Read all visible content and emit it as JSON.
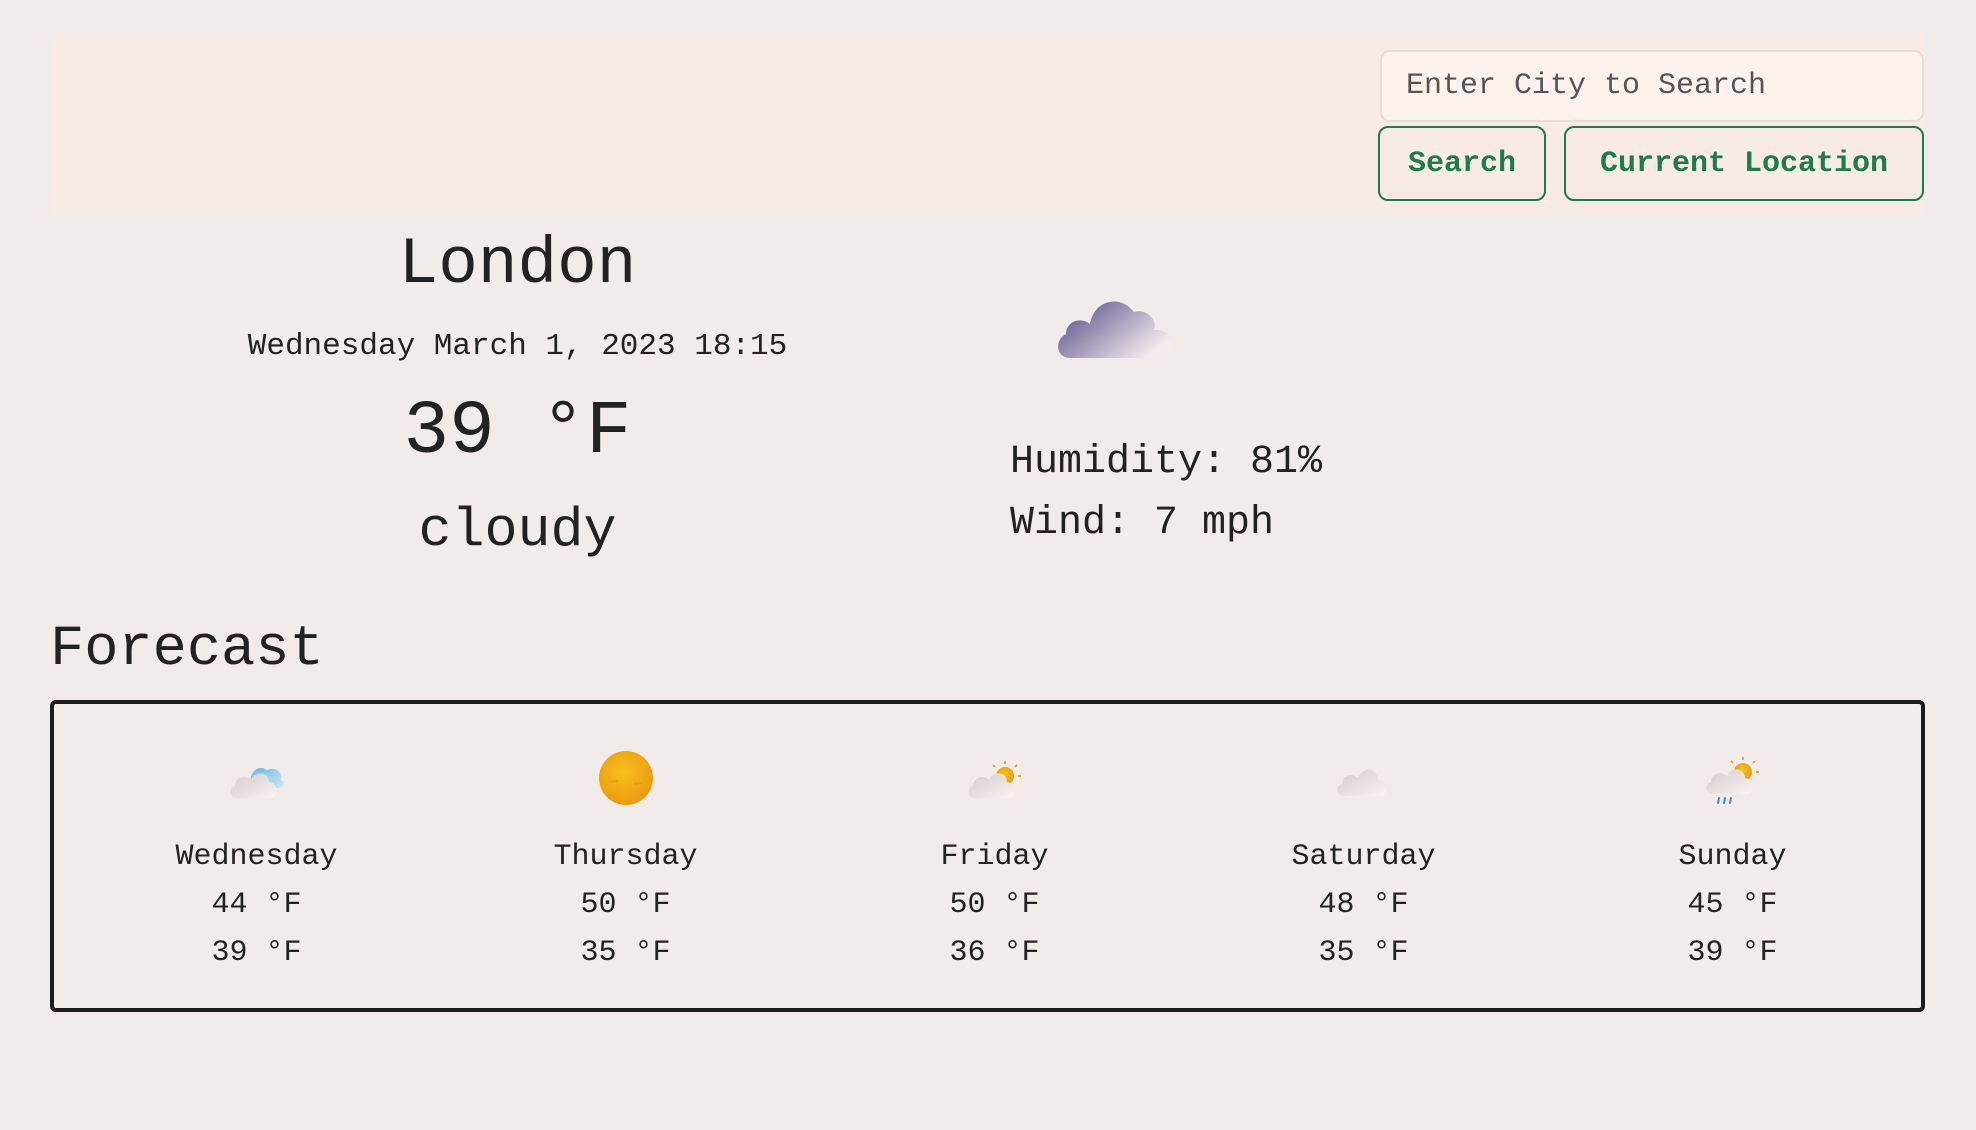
{
  "search": {
    "placeholder": "Enter City to Search",
    "search_label": "Search",
    "location_label": "Current Location"
  },
  "current": {
    "city": "London",
    "datetime": "Wednesday March 1, 2023 18:15",
    "temperature": "39 °F",
    "description": "cloudy",
    "icon": "cloudy-icon",
    "humidity": "Humidity: 81%",
    "wind": "Wind: 7 mph"
  },
  "forecast": {
    "title": "Forecast",
    "days": [
      {
        "day": "Wednesday",
        "high": "44 °F",
        "low": "39 °F",
        "icon": "cloud-blue-icon"
      },
      {
        "day": "Thursday",
        "high": "50 °F",
        "low": "35 °F",
        "icon": "sun-icon"
      },
      {
        "day": "Friday",
        "high": "50 °F",
        "low": "36 °F",
        "icon": "partly-cloudy-icon"
      },
      {
        "day": "Saturday",
        "high": "48 °F",
        "low": "35 °F",
        "icon": "cloud-icon"
      },
      {
        "day": "Sunday",
        "high": "45 °F",
        "low": "39 °F",
        "icon": "rain-sun-icon"
      }
    ]
  },
  "colors": {
    "background": "#f1ece9",
    "header": "#f8ebe3",
    "accent": "#1f7a4c",
    "text": "#222222"
  }
}
